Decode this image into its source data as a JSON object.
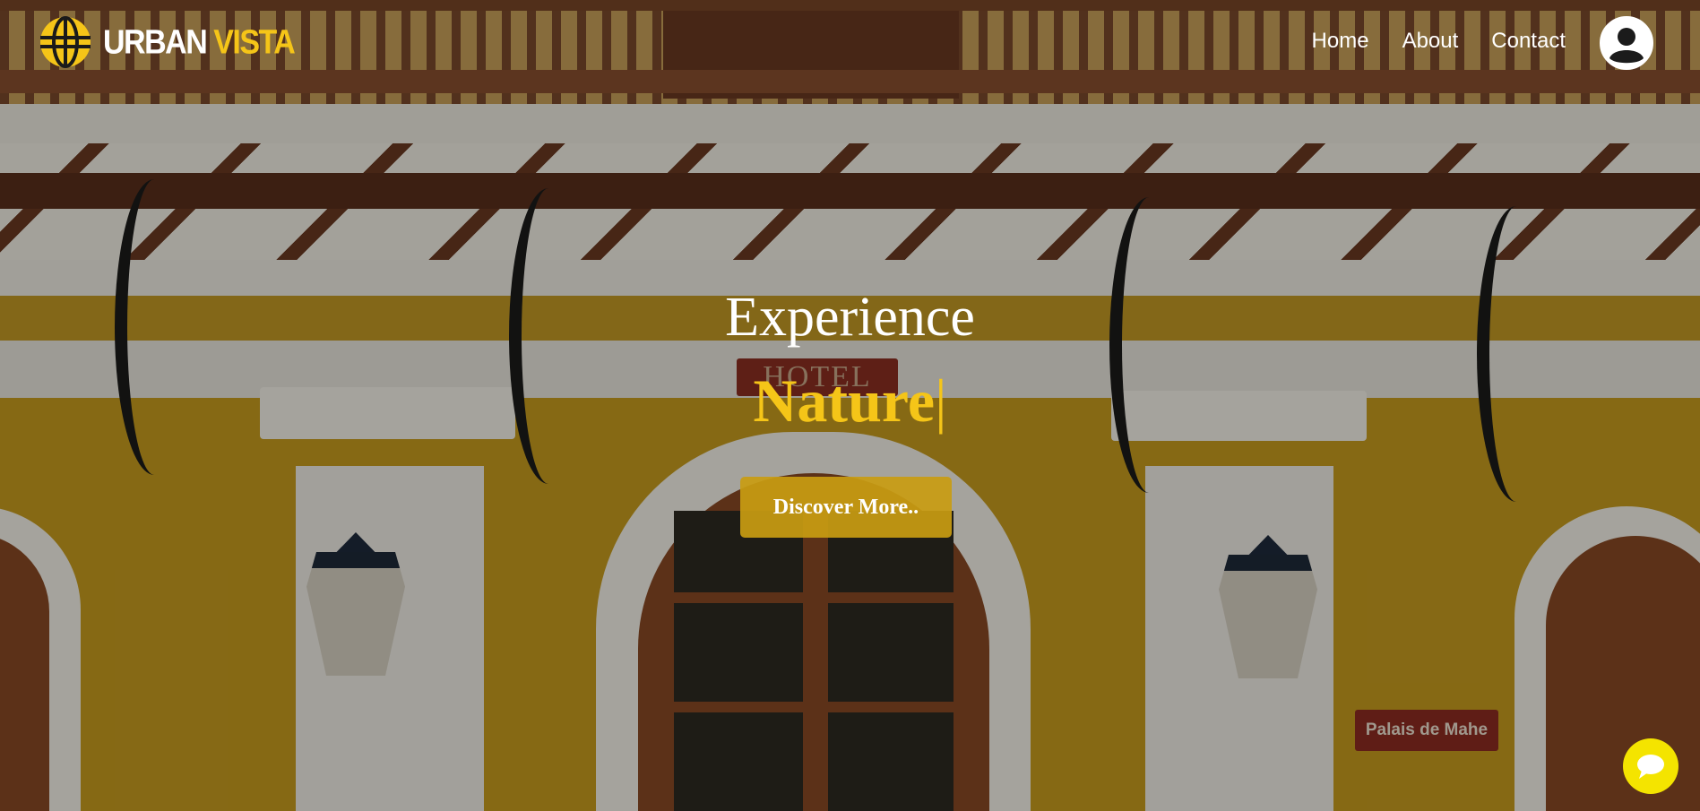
{
  "brand": {
    "part1": "URBAN",
    "part2": " VISTA",
    "icon": "globe-icon"
  },
  "nav": {
    "links": [
      "Home",
      "About",
      "Contact"
    ],
    "profile_icon": "user-circle-icon"
  },
  "hero": {
    "line1": "Experience",
    "line2": "Nature",
    "caret": "|",
    "cta_label": "Discover More.."
  },
  "scene": {
    "hotel_sign": "HOTEL",
    "shop_sign": "Palais de Mahe"
  },
  "chat": {
    "icon": "chat-bubble-icon"
  },
  "colors": {
    "accent": "#f5c518",
    "cta": "#c99c12",
    "chat": "#f4e400",
    "wall": "#c89d1f"
  }
}
